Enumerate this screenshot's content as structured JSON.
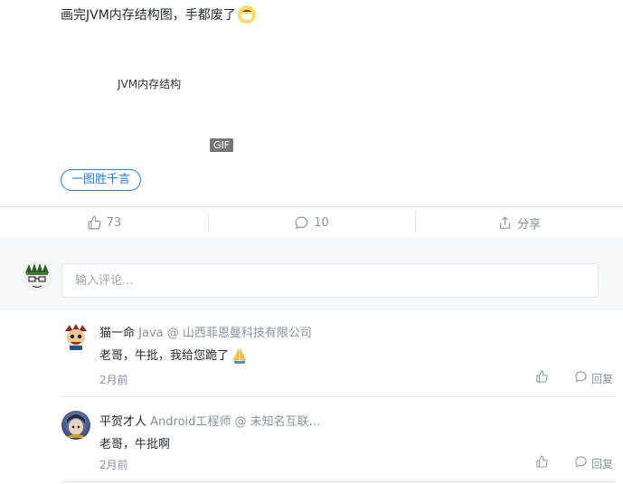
{
  "post": {
    "text": "画完JVM内存结构图，手都废了",
    "image_alt": "JVM内存结构",
    "gif_badge": "GIF",
    "topic": "一图胜千言"
  },
  "actions": {
    "like_count": "73",
    "comment_count": "10",
    "share_label": "分享"
  },
  "comment_input": {
    "placeholder": "输入评论..."
  },
  "comments": [
    {
      "author": "猫一命",
      "meta": "Java @ 山西菲恩曼科技有限公司",
      "text": "老哥，牛批，我给您跪了",
      "time": "2月前",
      "reply_label": "回复"
    },
    {
      "author": "平贺才人",
      "meta": "Android工程师 @ 未知名互联...",
      "text": "老哥，牛批啊",
      "time": "2月前",
      "reply_label": "回复"
    }
  ],
  "colors": {
    "accent": "#1e80ff",
    "muted": "#8a919f",
    "border": "#e5e6eb",
    "input_bg": "#f7f8fa"
  },
  "icons": [
    "mask-emoji-icon",
    "thumb-up-icon",
    "comment-bubble-icon",
    "share-icon",
    "pray-emoji-icon"
  ]
}
